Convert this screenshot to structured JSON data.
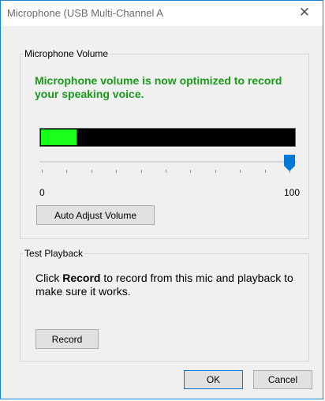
{
  "window": {
    "title": "Microphone (USB Multi-Channel A",
    "close_glyph": "✕"
  },
  "volume_group": {
    "legend": "Microphone Volume",
    "status": "Microphone volume is now optimized to record your speaking voice.",
    "status_color": "#1a9a1a",
    "meter_level": 0.14,
    "meter_color": "#1aff1a",
    "slider_value": 100,
    "slider_min_label": "0",
    "slider_max_label": "100",
    "auto_adjust_label": "Auto Adjust Volume"
  },
  "playback_group": {
    "legend": "Test Playback",
    "instruction_prefix": "Click ",
    "instruction_bold": "Record",
    "instruction_suffix": " to record from this mic and playback to make sure it works.",
    "record_label": "Record"
  },
  "footer": {
    "ok_label": "OK",
    "cancel_label": "Cancel"
  },
  "colors": {
    "accent": "#0078d7",
    "window_border": "#1783d7"
  }
}
